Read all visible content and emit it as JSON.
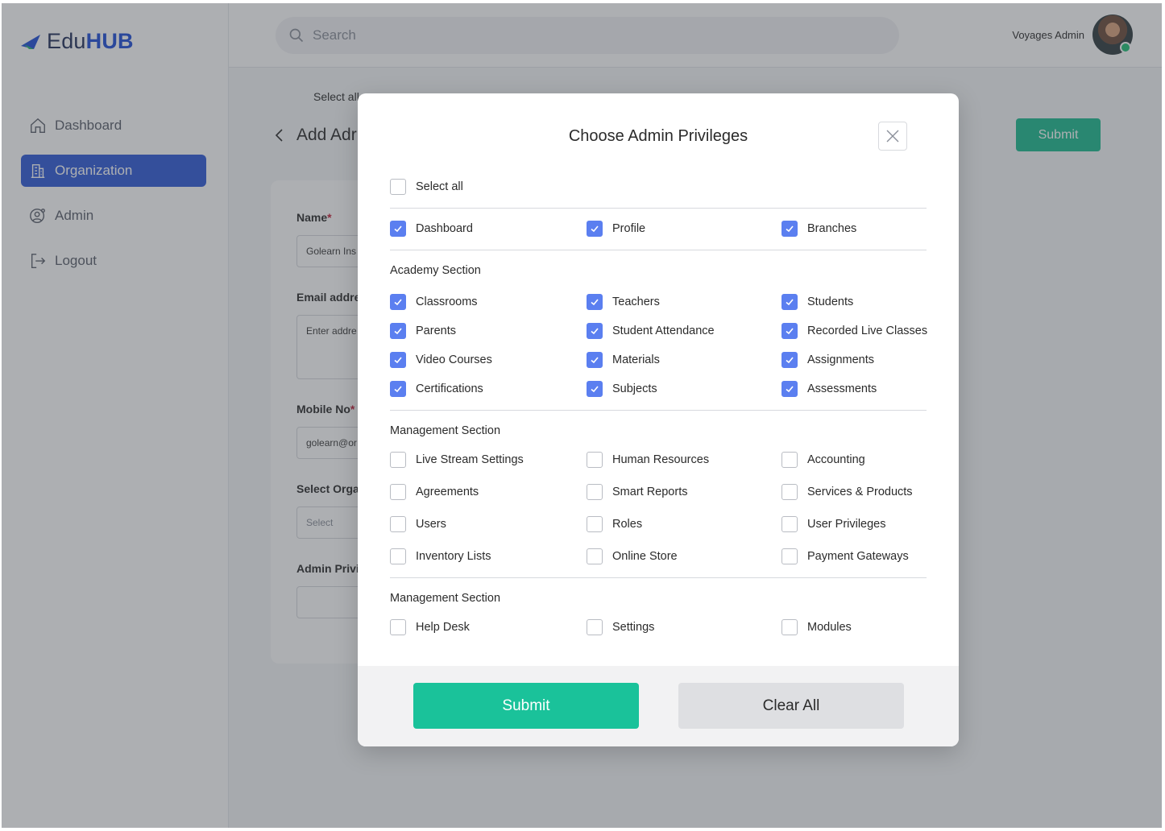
{
  "app": {
    "logo_prefix": "Edu",
    "logo_suffix": "HUB",
    "nav": [
      {
        "label": "Dashboard",
        "icon": "home-icon",
        "active": false
      },
      {
        "label": "Organization",
        "icon": "building-icon",
        "active": true
      },
      {
        "label": "Admin",
        "icon": "user-gear-icon",
        "active": false
      },
      {
        "label": "Logout",
        "icon": "logout-icon",
        "active": false
      }
    ],
    "search_placeholder": "Search",
    "user_name": "Voyages Admin"
  },
  "page": {
    "select_all": "Select all",
    "title": "Add Adr",
    "submit": "Submit",
    "form": {
      "name_label": "Name",
      "name_value": "Golearn Ins",
      "email_label": "Email addre",
      "email_placeholder": "Enter addre",
      "mobile_label": "Mobile No",
      "mobile_value": "golearn@or",
      "org_label": "Select Orga",
      "org_placeholder": "Select",
      "priv_label": "Admin Privi",
      "required_mark": "*"
    }
  },
  "modal": {
    "title": "Choose Admin Privileges",
    "select_all": {
      "label": "Select all",
      "checked": false
    },
    "general": [
      {
        "label": "Dashboard",
        "checked": true
      },
      {
        "label": "Profile",
        "checked": true
      },
      {
        "label": "Branches",
        "checked": true
      }
    ],
    "sections": [
      {
        "title": "Academy Section",
        "items": [
          {
            "label": "Classrooms",
            "checked": true
          },
          {
            "label": "Teachers",
            "checked": true
          },
          {
            "label": "Students",
            "checked": true
          },
          {
            "label": "Parents",
            "checked": true
          },
          {
            "label": "Student Attendance",
            "checked": true
          },
          {
            "label": "Recorded Live Classes",
            "checked": true
          },
          {
            "label": "Video Courses",
            "checked": true
          },
          {
            "label": "Materials",
            "checked": true
          },
          {
            "label": "Assignments",
            "checked": true
          },
          {
            "label": "Certifications",
            "checked": true
          },
          {
            "label": "Subjects",
            "checked": true
          },
          {
            "label": "Assessments",
            "checked": true
          }
        ]
      },
      {
        "title": "Management Section",
        "items": [
          {
            "label": "Live Stream Settings",
            "checked": false
          },
          {
            "label": "Human Resources",
            "checked": false
          },
          {
            "label": "Accounting",
            "checked": false
          },
          {
            "label": "Agreements",
            "checked": false
          },
          {
            "label": "Smart Reports",
            "checked": false
          },
          {
            "label": "Services & Products",
            "checked": false
          },
          {
            "label": "Users",
            "checked": false
          },
          {
            "label": "Roles",
            "checked": false
          },
          {
            "label": "User Privileges",
            "checked": false
          },
          {
            "label": "Inventory Lists",
            "checked": false
          },
          {
            "label": "Online Store",
            "checked": false
          },
          {
            "label": "Payment Gateways",
            "checked": false
          }
        ]
      },
      {
        "title": "Management Section",
        "items": [
          {
            "label": "Help Desk",
            "checked": false
          },
          {
            "label": "Settings",
            "checked": false
          },
          {
            "label": "Modules",
            "checked": false
          }
        ]
      }
    ],
    "submit_label": "Submit",
    "clear_label": "Clear All",
    "colors": {
      "checked": "#5b7ff0",
      "submit": "#1ac29a",
      "accent": "#2f5bd8"
    }
  }
}
